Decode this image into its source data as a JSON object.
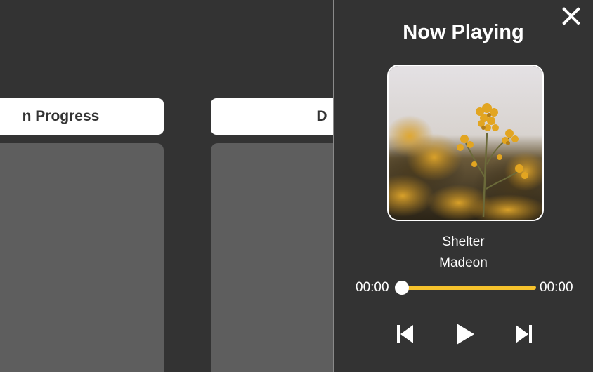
{
  "board": {
    "columns": [
      {
        "label": "In Progress",
        "visible_label": "n Progress"
      },
      {
        "label": "D"
      }
    ]
  },
  "player": {
    "title": "Now Playing",
    "track": {
      "title": "Shelter",
      "artist": "Madeon"
    },
    "time_current": "00:00",
    "time_total": "00:00",
    "progress": 0,
    "colors": {
      "accent": "#f6c22c",
      "background": "#333333",
      "text": "#ffffff"
    },
    "icons": {
      "close": "close-icon",
      "previous": "skip-previous-icon",
      "play": "play-icon",
      "next": "skip-next-icon"
    }
  }
}
